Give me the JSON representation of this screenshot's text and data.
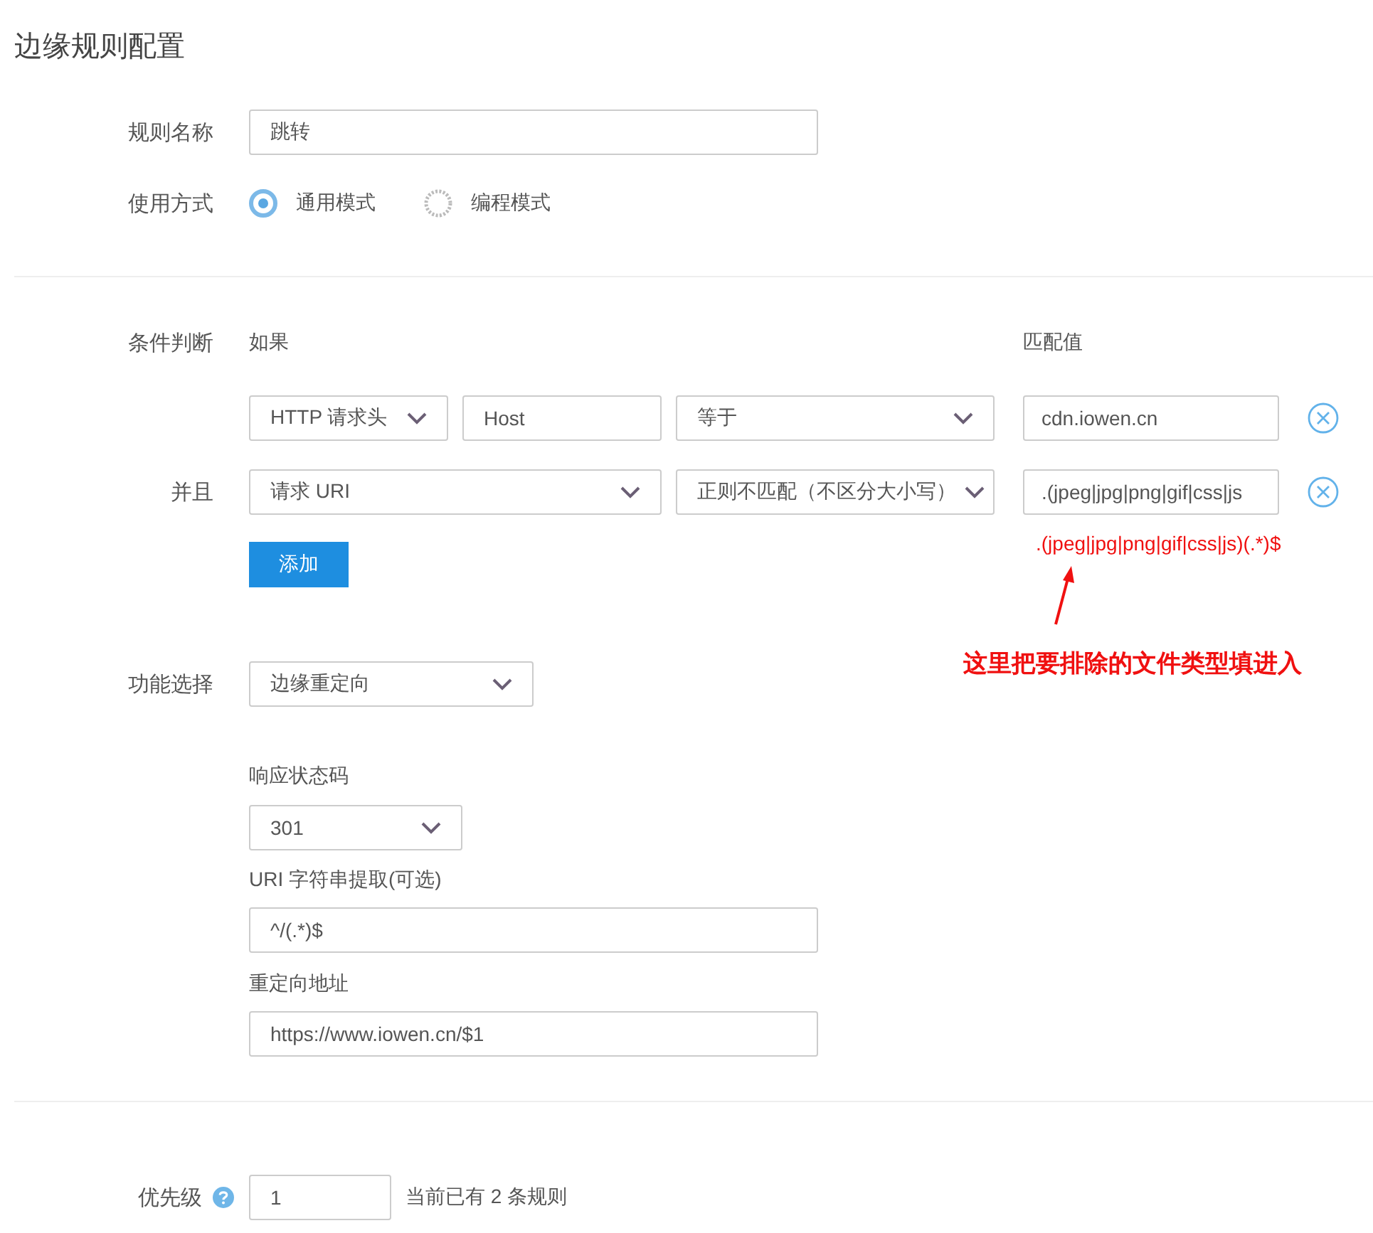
{
  "title": "边缘规则配置",
  "rule_name": {
    "label": "规则名称",
    "value": "跳转"
  },
  "usage": {
    "label": "使用方式",
    "options": [
      {
        "label": "通用模式",
        "selected": true
      },
      {
        "label": "编程模式",
        "selected": false
      }
    ]
  },
  "conditions": {
    "label": "条件判断",
    "header_if": "如果",
    "header_match": "匹配值",
    "rows": [
      {
        "fields": [
          {
            "kind": "select",
            "value": "HTTP 请求头"
          },
          {
            "kind": "input",
            "value": "Host"
          },
          {
            "kind": "select-wide",
            "value": "等于"
          },
          {
            "kind": "match",
            "value": "cdn.iowen.cn"
          }
        ]
      },
      {
        "prefix": "并且",
        "fields": [
          {
            "kind": "select-span",
            "value": "请求 URI"
          },
          {
            "kind": "select-wide",
            "value": "正则不匹配（不区分大小写）"
          },
          {
            "kind": "match",
            "value": ".(jpeg|jpg|png|gif|css|js"
          }
        ]
      }
    ],
    "add_button": "添加"
  },
  "function": {
    "label": "功能选择",
    "value": "边缘重定向"
  },
  "status_code": {
    "label": "响应状态码",
    "value": "301"
  },
  "uri_extract": {
    "label": "URI 字符串提取(可选)",
    "value": "^/(.*)$"
  },
  "redirect": {
    "label": "重定向地址",
    "value": "https://www.iowen.cn/$1"
  },
  "priority": {
    "label": "优先级",
    "value": "1",
    "note": "当前已有 2 条规则"
  },
  "annotation": {
    "example": ".(jpeg|jpg|png|gif|css|js)(.*)$",
    "note": "这里把要排除的文件类型填进入"
  }
}
